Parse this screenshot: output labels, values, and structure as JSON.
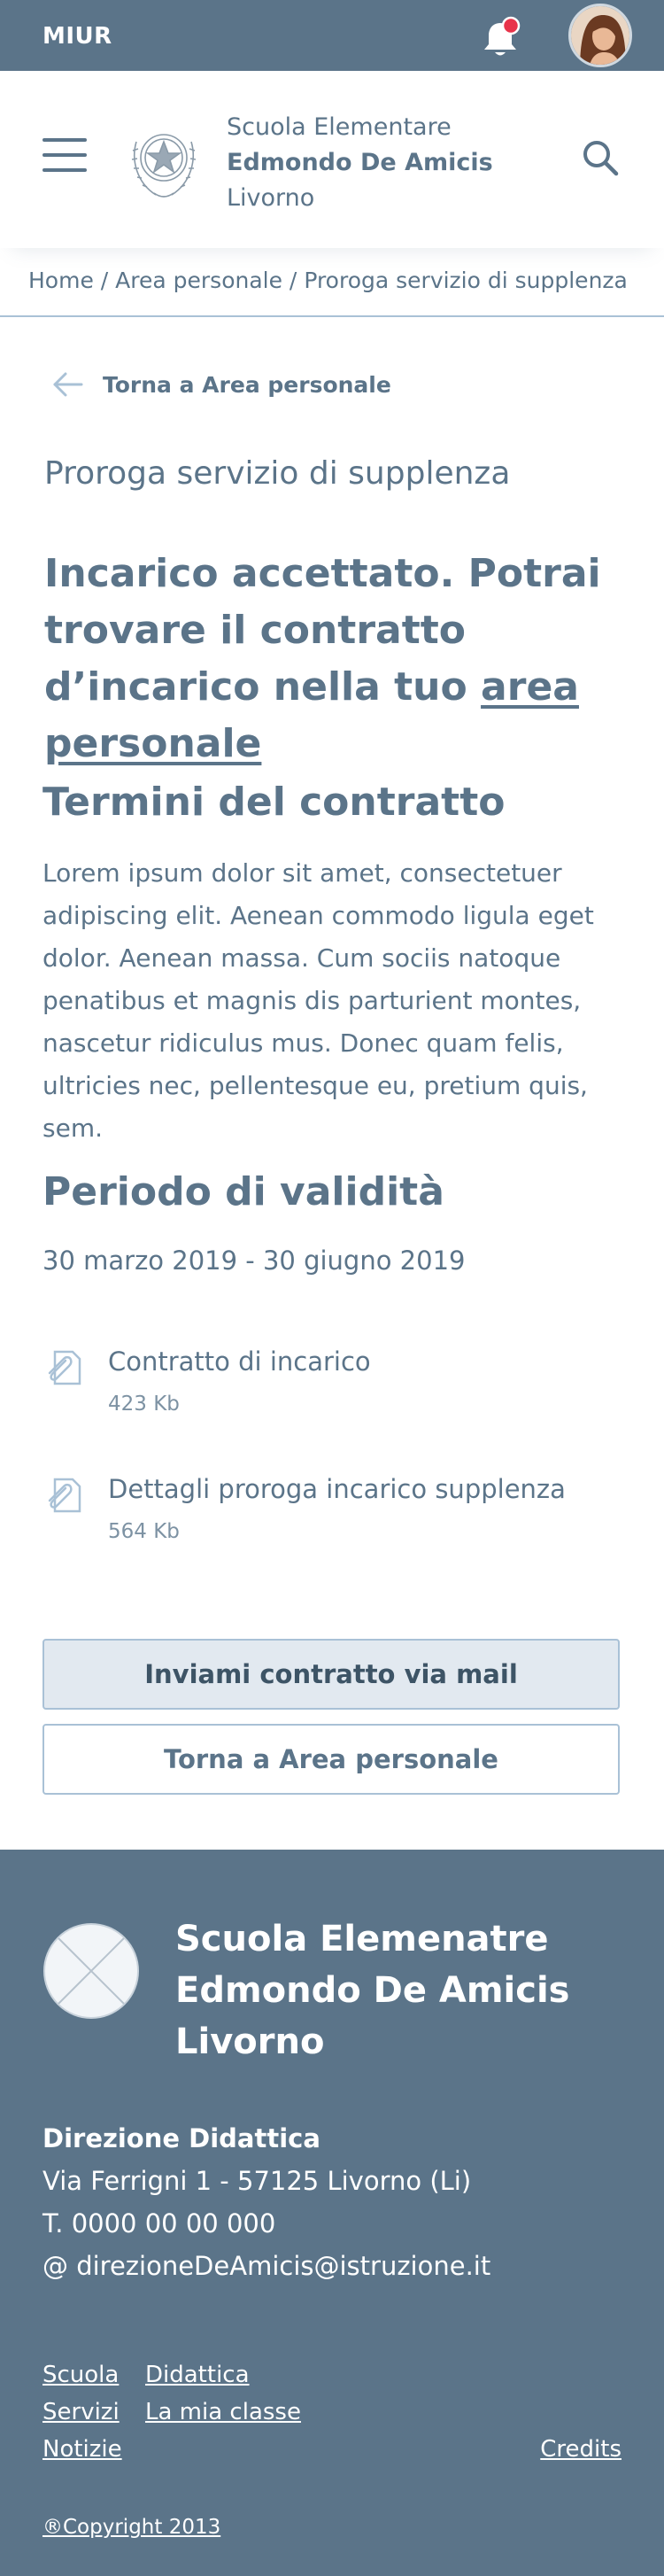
{
  "topbar": {
    "brand": "MIUR"
  },
  "header": {
    "school_line1": "Scuola Elementare",
    "school_line2": "Edmondo De Amicis",
    "school_line3": "Livorno"
  },
  "breadcrumb": {
    "items": [
      "Home",
      "Area personale",
      "Proroga servizio di supplenza"
    ],
    "separator": " / "
  },
  "back_link": {
    "label": "Torna a Area personale"
  },
  "page": {
    "subtitle": "Proroga servizio di supplenza",
    "headline_pre": "Incarico accettato. Potrai trovare il contratto d’incarico nella tuo ",
    "headline_link": "area personale"
  },
  "terms": {
    "title": "Termini del contratto",
    "text": "Lorem ipsum dolor sit amet, consectetuer adipiscing elit. Aenean commodo ligula eget dolor. Aenean massa. Cum sociis natoque penatibus et magnis dis parturient montes, nascetur ridiculus mus. Donec quam felis, ultricies nec, pellentesque eu, pretium quis, sem."
  },
  "validity": {
    "title": "Periodo di validità",
    "dates": "30 marzo 2019 - 30 giugno 2019"
  },
  "attachments": [
    {
      "name": "Contratto di incarico",
      "size": "423 Kb",
      "icon": "paperclip-icon"
    },
    {
      "name": "Dettagli proroga incarico supplenza",
      "size": "564 Kb",
      "icon": "paperclip-icon"
    }
  ],
  "buttons": {
    "primary": "Inviami contratto via mail",
    "secondary": "Torna a Area personale"
  },
  "footer": {
    "title_line1": "Scuola Elemenatre",
    "title_line2": "Edmondo De Amicis",
    "title_line3": "Livorno",
    "direction": "Direzione Didattica",
    "address": "Via Ferrigni 1 - 57125 Livorno (Li)",
    "phone": "T. 0000 00 00 000",
    "email": "@ direzioneDeAmicis@istruzione.it",
    "links": [
      "Scuola",
      "Didattica",
      "Servizi",
      "La mia classe",
      "Notizie",
      "Credits"
    ],
    "copyright": "®Copyright 2013"
  },
  "colors": {
    "primary": "#5b7489",
    "notification": "#e8334a",
    "divider": "#a9c1d6",
    "button_fill": "#e2e9f0"
  }
}
